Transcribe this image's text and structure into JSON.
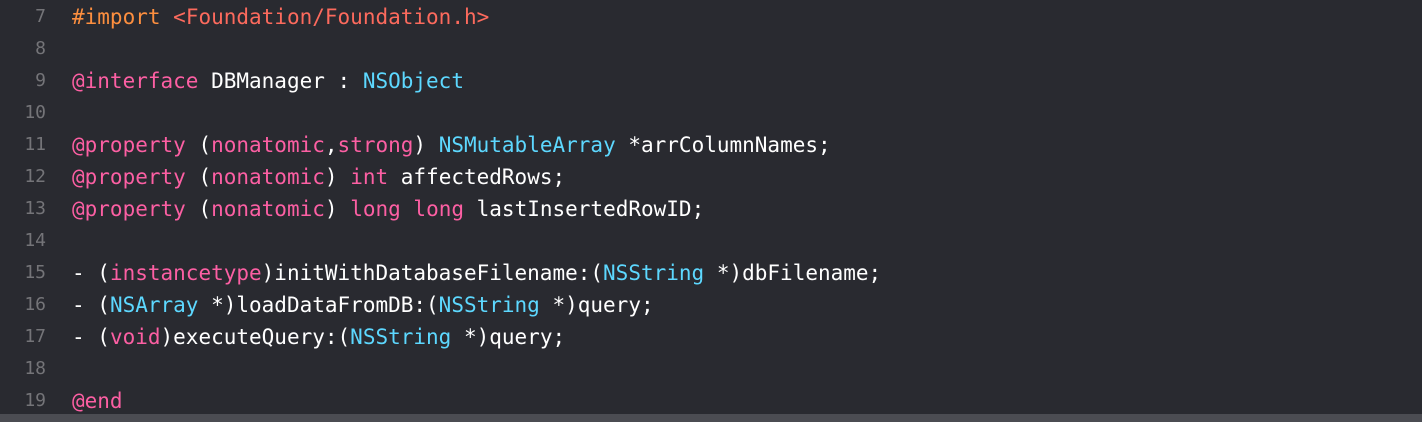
{
  "editor": {
    "language": "Objective-C",
    "colors": {
      "background": "#292a30",
      "line_number": "#747478",
      "plain": "#ffffff",
      "macro": "#fd8f3f",
      "string": "#fc6a5d",
      "keyword": "#fc5fa3",
      "type": "#5dd8ff"
    },
    "lines": [
      {
        "number": "7",
        "tokens": [
          {
            "text": "#import",
            "kind": "macro"
          },
          {
            "text": " ",
            "kind": "plain"
          },
          {
            "text": "<Foundation/Foundation.h>",
            "kind": "string"
          }
        ]
      },
      {
        "number": "8",
        "tokens": []
      },
      {
        "number": "9",
        "tokens": [
          {
            "text": "@interface",
            "kind": "keyword"
          },
          {
            "text": " DBManager : ",
            "kind": "plain"
          },
          {
            "text": "NSObject",
            "kind": "type"
          }
        ]
      },
      {
        "number": "10",
        "tokens": []
      },
      {
        "number": "11",
        "tokens": [
          {
            "text": "@property",
            "kind": "keyword"
          },
          {
            "text": " (",
            "kind": "plain"
          },
          {
            "text": "nonatomic",
            "kind": "keyword"
          },
          {
            "text": ",",
            "kind": "plain"
          },
          {
            "text": "strong",
            "kind": "keyword"
          },
          {
            "text": ") ",
            "kind": "plain"
          },
          {
            "text": "NSMutableArray",
            "kind": "type"
          },
          {
            "text": " *arrColumnNames;",
            "kind": "plain"
          }
        ]
      },
      {
        "number": "12",
        "tokens": [
          {
            "text": "@property",
            "kind": "keyword"
          },
          {
            "text": " (",
            "kind": "plain"
          },
          {
            "text": "nonatomic",
            "kind": "keyword"
          },
          {
            "text": ") ",
            "kind": "plain"
          },
          {
            "text": "int",
            "kind": "keyword"
          },
          {
            "text": " affectedRows;",
            "kind": "plain"
          }
        ]
      },
      {
        "number": "13",
        "tokens": [
          {
            "text": "@property",
            "kind": "keyword"
          },
          {
            "text": " (",
            "kind": "plain"
          },
          {
            "text": "nonatomic",
            "kind": "keyword"
          },
          {
            "text": ") ",
            "kind": "plain"
          },
          {
            "text": "long",
            "kind": "keyword"
          },
          {
            "text": " ",
            "kind": "plain"
          },
          {
            "text": "long",
            "kind": "keyword"
          },
          {
            "text": " lastInsertedRowID;",
            "kind": "plain"
          }
        ]
      },
      {
        "number": "14",
        "tokens": []
      },
      {
        "number": "15",
        "tokens": [
          {
            "text": "- (",
            "kind": "plain"
          },
          {
            "text": "instancetype",
            "kind": "keyword"
          },
          {
            "text": ")initWithDatabaseFilename:(",
            "kind": "plain"
          },
          {
            "text": "NSString",
            "kind": "type"
          },
          {
            "text": " *)dbFilename;",
            "kind": "plain"
          }
        ]
      },
      {
        "number": "16",
        "tokens": [
          {
            "text": "- (",
            "kind": "plain"
          },
          {
            "text": "NSArray",
            "kind": "type"
          },
          {
            "text": " *)loadDataFromDB:(",
            "kind": "plain"
          },
          {
            "text": "NSString",
            "kind": "type"
          },
          {
            "text": " *)query;",
            "kind": "plain"
          }
        ]
      },
      {
        "number": "17",
        "tokens": [
          {
            "text": "- (",
            "kind": "plain"
          },
          {
            "text": "void",
            "kind": "keyword"
          },
          {
            "text": ")executeQuery:(",
            "kind": "plain"
          },
          {
            "text": "NSString",
            "kind": "type"
          },
          {
            "text": " *)query;",
            "kind": "plain"
          }
        ]
      },
      {
        "number": "18",
        "tokens": []
      },
      {
        "number": "19",
        "tokens": [
          {
            "text": "@end",
            "kind": "keyword"
          }
        ]
      }
    ]
  }
}
